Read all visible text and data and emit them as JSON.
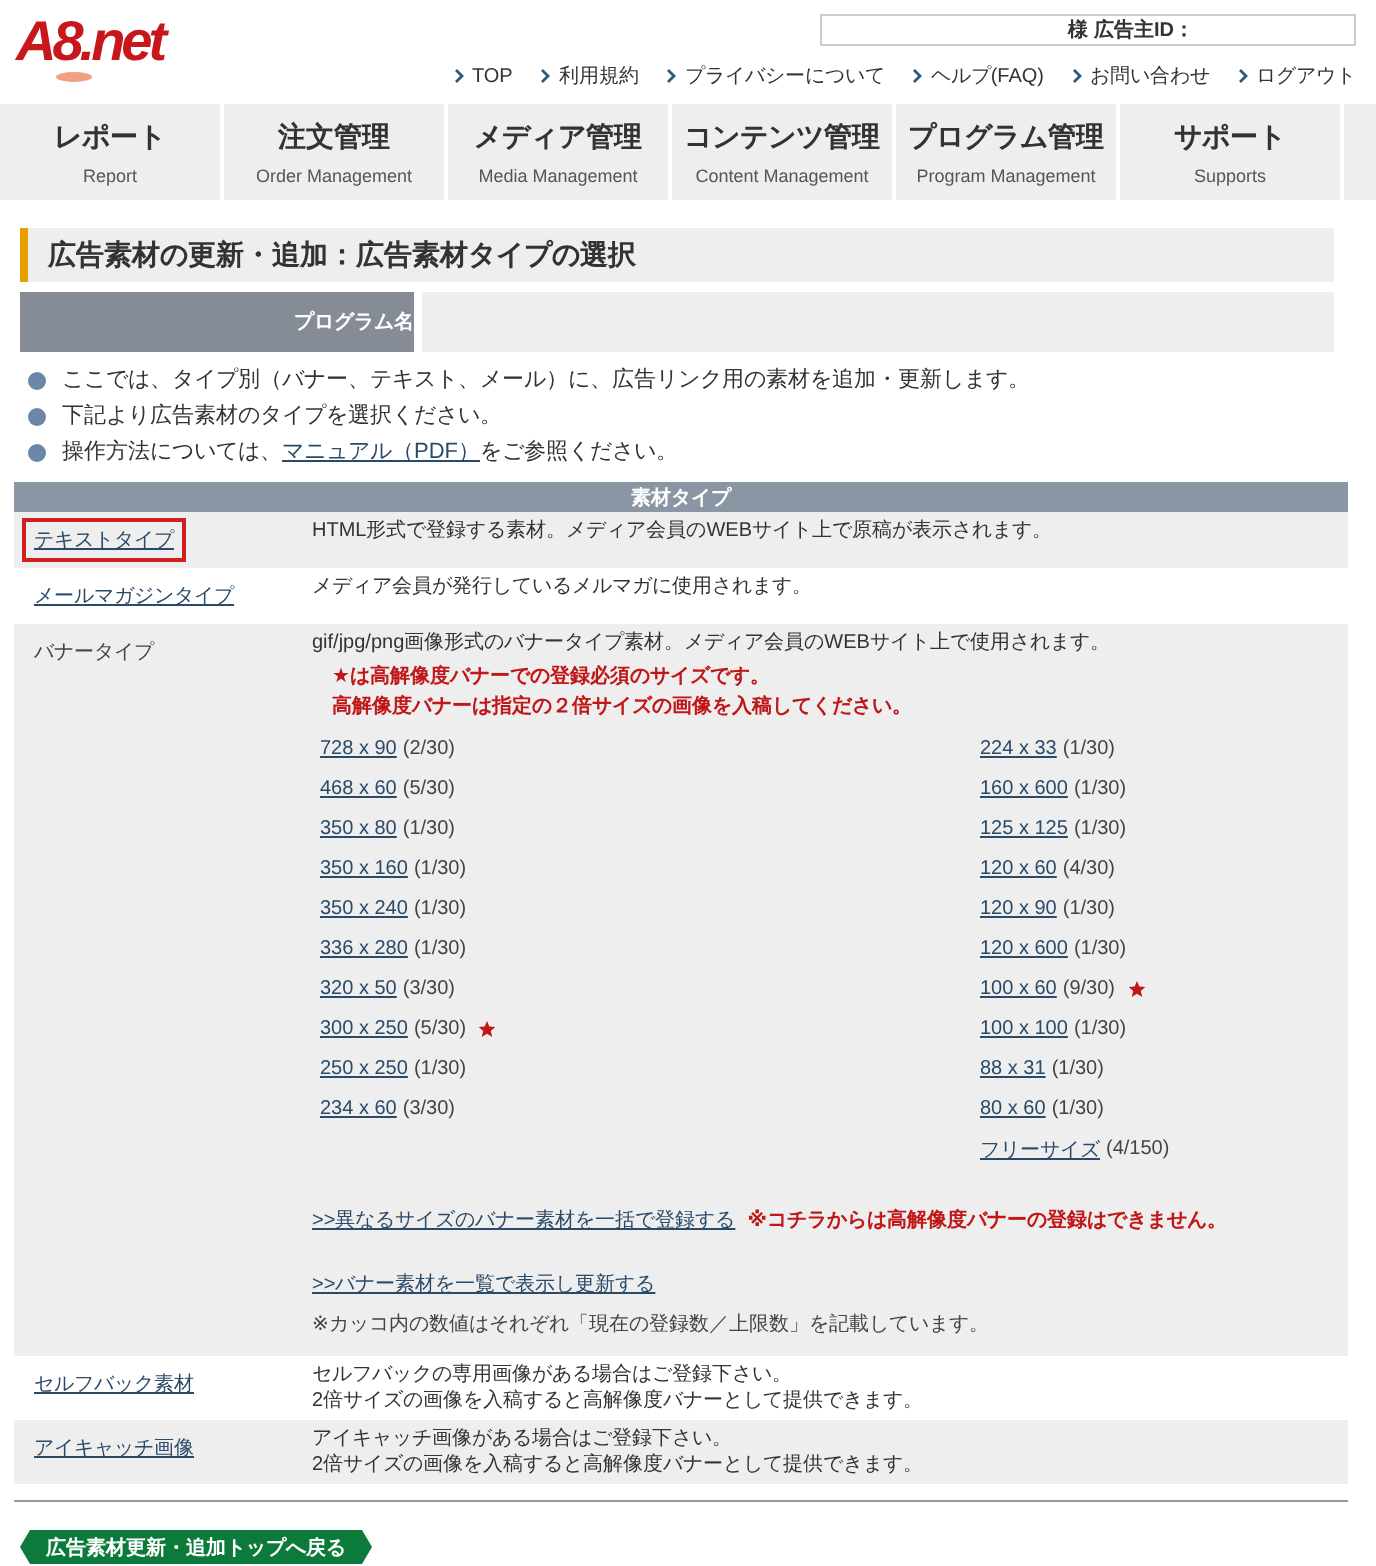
{
  "header": {
    "logo": "A8.net",
    "account_label": "様 広告主ID：",
    "links": [
      "TOP",
      "利用規約",
      "プライバシーについて",
      "ヘルプ(FAQ)",
      "お問い合わせ",
      "ログアウト"
    ]
  },
  "menu": [
    {
      "label": "レポート",
      "sub": "Report"
    },
    {
      "label": "注文管理",
      "sub": "Order Management"
    },
    {
      "label": "メディア管理",
      "sub": "Media Management"
    },
    {
      "label": "コンテンツ管理",
      "sub": "Content Management"
    },
    {
      "label": "プログラム管理",
      "sub": "Program Management"
    },
    {
      "label": "サポート",
      "sub": "Supports"
    }
  ],
  "page_title": "広告素材の更新・追加：広告素材タイプの選択",
  "program_label": "プログラム名",
  "notes": [
    {
      "text": "ここでは、タイプ別（バナー、テキスト、メール）に、広告リンク用の素材を追加・更新します。"
    },
    {
      "text": "下記より広告素材のタイプを選択ください。"
    },
    {
      "text": "操作方法については、",
      "link": "マニュアル（PDF）",
      "after": "をご参照ください。"
    }
  ],
  "table": {
    "header": "素材タイプ",
    "rows": [
      {
        "kind": "plain",
        "name": "テキストタイプ",
        "highlighted": true,
        "lines": [
          "HTML形式で登録する素材。メディア会員のWEBサイト上で原稿が表示されます。"
        ]
      },
      {
        "kind": "plain",
        "name": "メールマガジンタイプ",
        "highlighted": false,
        "lines": [
          "メディア会員が発行しているメルマガに使用されます。"
        ]
      },
      {
        "kind": "banner",
        "name": "バナータイプ",
        "highlighted": false,
        "lines": [
          "gif/jpg/png画像形式のバナータイプ素材。メディア会員のWEBサイト上で使用されます。"
        ],
        "warnings": [
          "★は高解像度バナーでの登録必須のサイズです。",
          "高解像度バナーは指定の２倍サイズの画像を入稿してください。"
        ],
        "sizes_left": [
          {
            "size": "728 x 90",
            "count": "(2/30)",
            "required": false
          },
          {
            "size": "468 x 60",
            "count": "(5/30)",
            "required": false
          },
          {
            "size": "350 x 80",
            "count": "(1/30)",
            "required": false
          },
          {
            "size": "350 x 160",
            "count": "(1/30)",
            "required": false
          },
          {
            "size": "350 x 240",
            "count": "(1/30)",
            "required": false
          },
          {
            "size": "336 x 280",
            "count": "(1/30)",
            "required": false
          },
          {
            "size": "320 x 50",
            "count": "(3/30)",
            "required": false
          },
          {
            "size": "300 x 250",
            "count": "(5/30)",
            "required": true
          },
          {
            "size": "250 x 250",
            "count": "(1/30)",
            "required": false
          },
          {
            "size": "234 x 60",
            "count": "(3/30)",
            "required": false
          }
        ],
        "sizes_right": [
          {
            "size": "224 x 33",
            "count": "(1/30)",
            "required": false
          },
          {
            "size": "160 x 600",
            "count": "(1/30)",
            "required": false
          },
          {
            "size": "125 x 125",
            "count": "(1/30)",
            "required": false
          },
          {
            "size": "120 x 60",
            "count": "(4/30)",
            "required": false
          },
          {
            "size": "120 x 90",
            "count": "(1/30)",
            "required": false
          },
          {
            "size": "120 x 600",
            "count": "(1/30)",
            "required": false
          },
          {
            "size": "100 x 60",
            "count": "(9/30)",
            "required": true
          },
          {
            "size": "100 x 100",
            "count": "(1/30)",
            "required": false
          },
          {
            "size": "88 x 31",
            "count": "(1/30)",
            "required": false
          },
          {
            "size": "80 x 60",
            "count": "(1/30)",
            "required": false
          },
          {
            "size": "フリーサイズ",
            "count": "(4/150)",
            "required": false
          }
        ],
        "bulk_link": ">>異なるサイズのバナー素材を一括で登録する",
        "bulk_warning": "※コチラからは高解像度バナーの登録はできません。",
        "list_link": ">>バナー素材を一覧で表示し更新する",
        "footnote": "※カッコ内の数値はそれぞれ「現在の登録数／上限数」を記載しています。"
      },
      {
        "kind": "plain",
        "name": "セルフバック素材",
        "highlighted": false,
        "lines": [
          "セルフバックの専用画像がある場合はご登録下さい。",
          "2倍サイズの画像を入稿すると高解像度バナーとして提供できます。"
        ]
      },
      {
        "kind": "plain",
        "name": "アイキャッチ画像",
        "highlighted": false,
        "lines": [
          "アイキャッチ画像がある場合はご登録下さい。",
          "2倍サイズの画像を入稿すると高解像度バナーとして提供できます。"
        ]
      }
    ]
  },
  "back_button": "広告素材更新・追加トップへ戻る"
}
